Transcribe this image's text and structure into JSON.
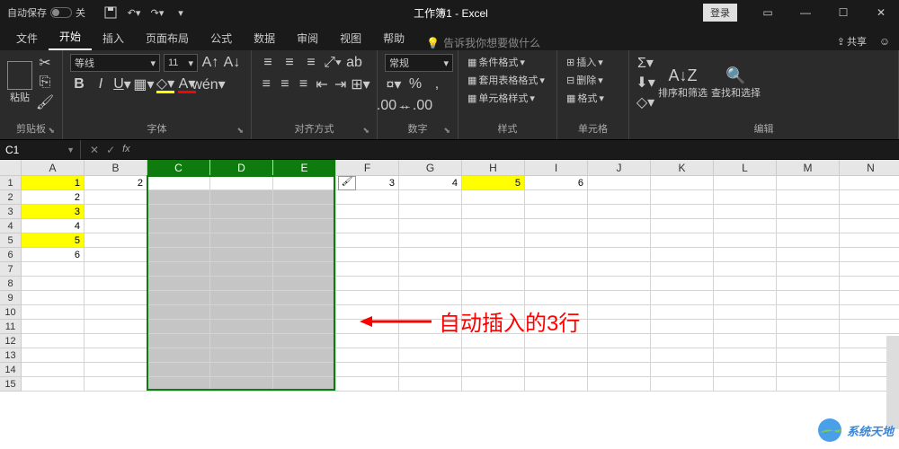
{
  "titlebar": {
    "autosave_label": "自动保存",
    "autosave_state": "关",
    "title": "工作簿1 - Excel",
    "login": "登录"
  },
  "tabs": {
    "file": "文件",
    "home": "开始",
    "insert": "插入",
    "layout": "页面布局",
    "formulas": "公式",
    "data": "数据",
    "review": "审阅",
    "view": "视图",
    "help": "帮助",
    "tell_me": "告诉我你想要做什么",
    "share": "共享"
  },
  "ribbon": {
    "clipboard": {
      "paste": "粘贴",
      "label": "剪贴板"
    },
    "font": {
      "name": "等线",
      "size": "11",
      "label": "字体"
    },
    "alignment": {
      "label": "对齐方式"
    },
    "number": {
      "format": "常规",
      "label": "数字"
    },
    "styles": {
      "conditional": "条件格式",
      "table": "套用表格格式",
      "cell": "单元格样式",
      "label": "样式"
    },
    "cells": {
      "insert": "插入",
      "delete": "删除",
      "format": "格式",
      "label": "单元格"
    },
    "editing": {
      "sort": "排序和筛选",
      "find": "查找和选择",
      "label": "编辑"
    }
  },
  "namebox": {
    "ref": "C1"
  },
  "columns": [
    "A",
    "B",
    "C",
    "D",
    "E",
    "F",
    "G",
    "H",
    "I",
    "J",
    "K",
    "L",
    "M",
    "N"
  ],
  "selected_columns": [
    "C",
    "D",
    "E"
  ],
  "rows": [
    1,
    2,
    3,
    4,
    5,
    6,
    7,
    8,
    9,
    10,
    11,
    12,
    13,
    14,
    15
  ],
  "cells": {
    "A1": {
      "v": "1",
      "fill": "yellow"
    },
    "B1": {
      "v": "2"
    },
    "F1": {
      "v": "3"
    },
    "G1": {
      "v": "4"
    },
    "H1": {
      "v": "5",
      "fill": "yellow"
    },
    "I1": {
      "v": "6"
    },
    "A2": {
      "v": "2"
    },
    "A3": {
      "v": "3",
      "fill": "yellow"
    },
    "A4": {
      "v": "4"
    },
    "A5": {
      "v": "5",
      "fill": "yellow"
    },
    "A6": {
      "v": "6"
    }
  },
  "annotation": {
    "text": "自动插入的3行"
  },
  "watermark": {
    "text": "系统天地"
  }
}
